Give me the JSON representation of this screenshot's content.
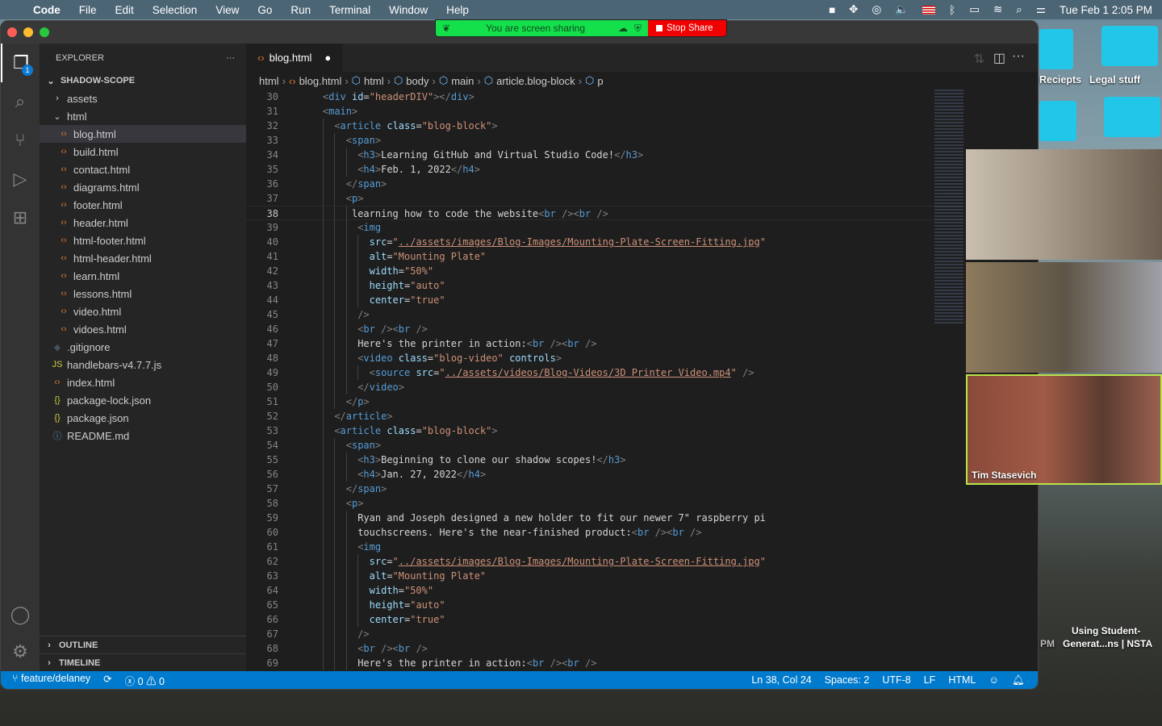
{
  "menubar": {
    "app": "Code",
    "items": [
      "File",
      "Edit",
      "Selection",
      "View",
      "Go",
      "Run",
      "Terminal",
      "Window",
      "Help"
    ],
    "clock": "Tue Feb 1  2:05 PM"
  },
  "share": {
    "status": "You are screen sharing",
    "stop": "Stop Share"
  },
  "desktop": {
    "folders": [
      "Reciepts",
      "Legal stuff"
    ],
    "bottom_label_1": "Using Student-",
    "bottom_label_2": "Generat...ns | NSTA",
    "pm": "PM"
  },
  "video": {
    "speaker": "Tim Stasevich"
  },
  "sidebar": {
    "title": "EXPLORER",
    "more": "···",
    "root": "SHADOW-SCOPE",
    "items": [
      {
        "label": "assets",
        "type": "folder",
        "depth": 1,
        "icon": "›"
      },
      {
        "label": "html",
        "type": "folder-open",
        "depth": 1,
        "icon": "⌄"
      },
      {
        "label": "blog.html",
        "type": "html",
        "depth": 2,
        "selected": true
      },
      {
        "label": "build.html",
        "type": "html",
        "depth": 2
      },
      {
        "label": "contact.html",
        "type": "html",
        "depth": 2
      },
      {
        "label": "diagrams.html",
        "type": "html",
        "depth": 2
      },
      {
        "label": "footer.html",
        "type": "html",
        "depth": 2
      },
      {
        "label": "header.html",
        "type": "html",
        "depth": 2
      },
      {
        "label": "html-footer.html",
        "type": "html",
        "depth": 2
      },
      {
        "label": "html-header.html",
        "type": "html",
        "depth": 2
      },
      {
        "label": "learn.html",
        "type": "html",
        "depth": 2
      },
      {
        "label": "lessons.html",
        "type": "html",
        "depth": 2
      },
      {
        "label": "video.html",
        "type": "html",
        "depth": 2
      },
      {
        "label": "vidoes.html",
        "type": "html",
        "depth": 2
      },
      {
        "label": ".gitignore",
        "type": "git",
        "depth": 1
      },
      {
        "label": "handlebars-v4.7.7.js",
        "type": "js",
        "depth": 1
      },
      {
        "label": "index.html",
        "type": "html",
        "depth": 1
      },
      {
        "label": "package-lock.json",
        "type": "json",
        "depth": 1
      },
      {
        "label": "package.json",
        "type": "json",
        "depth": 1
      },
      {
        "label": "README.md",
        "type": "info",
        "depth": 1
      }
    ],
    "outline": "OUTLINE",
    "timeline": "TIMELINE"
  },
  "explorer_badge": "1",
  "editor": {
    "tab": "blog.html",
    "breadcrumb": [
      "html",
      "blog.html",
      "html",
      "body",
      "main",
      "article.blog-block",
      "p"
    ],
    "current_line": 38,
    "lines": [
      [
        30,
        4,
        [
          [
            "p",
            "<"
          ],
          [
            "g",
            "div "
          ],
          [
            "a",
            "id"
          ],
          [
            "x",
            "="
          ],
          [
            "s",
            "\"headerDIV\""
          ],
          [
            "p",
            "></"
          ],
          [
            "g",
            "div"
          ],
          [
            "p",
            ">"
          ]
        ]
      ],
      [
        31,
        4,
        [
          [
            "p",
            "<"
          ],
          [
            "g",
            "main"
          ],
          [
            "p",
            ">"
          ]
        ]
      ],
      [
        32,
        6,
        [
          [
            "p",
            "<"
          ],
          [
            "g",
            "article "
          ],
          [
            "a",
            "class"
          ],
          [
            "x",
            "="
          ],
          [
            "s",
            "\"blog-block\""
          ],
          [
            "p",
            ">"
          ]
        ]
      ],
      [
        33,
        8,
        [
          [
            "p",
            "<"
          ],
          [
            "g",
            "span"
          ],
          [
            "p",
            ">"
          ]
        ]
      ],
      [
        34,
        10,
        [
          [
            "p",
            "<"
          ],
          [
            "g",
            "h3"
          ],
          [
            "p",
            ">"
          ],
          [
            "x",
            "Learning GitHub and Virtual Studio Code!"
          ],
          [
            "p",
            "</"
          ],
          [
            "g",
            "h3"
          ],
          [
            "p",
            ">"
          ]
        ]
      ],
      [
        35,
        10,
        [
          [
            "p",
            "<"
          ],
          [
            "g",
            "h4"
          ],
          [
            "p",
            ">"
          ],
          [
            "x",
            "Feb. 1, 2022"
          ],
          [
            "p",
            "</"
          ],
          [
            "g",
            "h4"
          ],
          [
            "p",
            ">"
          ]
        ]
      ],
      [
        36,
        8,
        [
          [
            "p",
            "</"
          ],
          [
            "g",
            "span"
          ],
          [
            "p",
            ">"
          ]
        ]
      ],
      [
        37,
        8,
        [
          [
            "p",
            "<"
          ],
          [
            "g",
            "p"
          ],
          [
            "p",
            ">"
          ]
        ]
      ],
      [
        38,
        9,
        [
          [
            "x",
            "learning how to code the website"
          ],
          [
            "p",
            "<"
          ],
          [
            "g",
            "br"
          ],
          [
            "p",
            " /><"
          ],
          [
            "g",
            "br"
          ],
          [
            "p",
            " />"
          ]
        ]
      ],
      [
        39,
        10,
        [
          [
            "p",
            "<"
          ],
          [
            "g",
            "img"
          ]
        ]
      ],
      [
        40,
        12,
        [
          [
            "a",
            "src"
          ],
          [
            "x",
            "="
          ],
          [
            "s",
            "\""
          ],
          [
            "u",
            "../assets/images/Blog-Images/Mounting-Plate-Screen-Fitting.jpg"
          ],
          [
            "s",
            "\""
          ]
        ]
      ],
      [
        41,
        12,
        [
          [
            "a",
            "alt"
          ],
          [
            "x",
            "="
          ],
          [
            "s",
            "\"Mounting Plate\""
          ]
        ]
      ],
      [
        42,
        12,
        [
          [
            "a",
            "width"
          ],
          [
            "x",
            "="
          ],
          [
            "s",
            "\"50%\""
          ]
        ]
      ],
      [
        43,
        12,
        [
          [
            "a",
            "height"
          ],
          [
            "x",
            "="
          ],
          [
            "s",
            "\"auto\""
          ]
        ]
      ],
      [
        44,
        12,
        [
          [
            "a",
            "center"
          ],
          [
            "x",
            "="
          ],
          [
            "s",
            "\"true\""
          ]
        ]
      ],
      [
        45,
        10,
        [
          [
            "p",
            "/>"
          ]
        ]
      ],
      [
        46,
        10,
        [
          [
            "p",
            "<"
          ],
          [
            "g",
            "br"
          ],
          [
            "p",
            " /><"
          ],
          [
            "g",
            "br"
          ],
          [
            "p",
            " />"
          ]
        ]
      ],
      [
        47,
        10,
        [
          [
            "x",
            "Here's the printer in action:"
          ],
          [
            "p",
            "<"
          ],
          [
            "g",
            "br"
          ],
          [
            "p",
            " /><"
          ],
          [
            "g",
            "br"
          ],
          [
            "p",
            " />"
          ]
        ]
      ],
      [
        48,
        10,
        [
          [
            "p",
            "<"
          ],
          [
            "g",
            "video "
          ],
          [
            "a",
            "class"
          ],
          [
            "x",
            "="
          ],
          [
            "s",
            "\"blog-video\" "
          ],
          [
            "a",
            "controls"
          ],
          [
            "p",
            ">"
          ]
        ]
      ],
      [
        49,
        12,
        [
          [
            "p",
            "<"
          ],
          [
            "g",
            "source "
          ],
          [
            "a",
            "src"
          ],
          [
            "x",
            "="
          ],
          [
            "s",
            "\""
          ],
          [
            "u",
            "../assets/videos/Blog-Videos/3D Printer Video.mp4"
          ],
          [
            "s",
            "\""
          ],
          [
            "p",
            " />"
          ]
        ]
      ],
      [
        50,
        10,
        [
          [
            "p",
            "</"
          ],
          [
            "g",
            "video"
          ],
          [
            "p",
            ">"
          ]
        ]
      ],
      [
        51,
        8,
        [
          [
            "p",
            "</"
          ],
          [
            "g",
            "p"
          ],
          [
            "p",
            ">"
          ]
        ]
      ],
      [
        52,
        6,
        [
          [
            "p",
            "</"
          ],
          [
            "g",
            "article"
          ],
          [
            "p",
            ">"
          ]
        ]
      ],
      [
        53,
        6,
        [
          [
            "p",
            "<"
          ],
          [
            "g",
            "article "
          ],
          [
            "a",
            "class"
          ],
          [
            "x",
            "="
          ],
          [
            "s",
            "\"blog-block\""
          ],
          [
            "p",
            ">"
          ]
        ]
      ],
      [
        54,
        8,
        [
          [
            "p",
            "<"
          ],
          [
            "g",
            "span"
          ],
          [
            "p",
            ">"
          ]
        ]
      ],
      [
        55,
        10,
        [
          [
            "p",
            "<"
          ],
          [
            "g",
            "h3"
          ],
          [
            "p",
            ">"
          ],
          [
            "x",
            "Beginning to clone our shadow scopes!"
          ],
          [
            "p",
            "</"
          ],
          [
            "g",
            "h3"
          ],
          [
            "p",
            ">"
          ]
        ]
      ],
      [
        56,
        10,
        [
          [
            "p",
            "<"
          ],
          [
            "g",
            "h4"
          ],
          [
            "p",
            ">"
          ],
          [
            "x",
            "Jan. 27, 2022"
          ],
          [
            "p",
            "</"
          ],
          [
            "g",
            "h4"
          ],
          [
            "p",
            ">"
          ]
        ]
      ],
      [
        57,
        8,
        [
          [
            "p",
            "</"
          ],
          [
            "g",
            "span"
          ],
          [
            "p",
            ">"
          ]
        ]
      ],
      [
        58,
        8,
        [
          [
            "p",
            "<"
          ],
          [
            "g",
            "p"
          ],
          [
            "p",
            ">"
          ]
        ]
      ],
      [
        59,
        10,
        [
          [
            "x",
            "Ryan and Joseph designed a new holder to fit our newer 7\" raspberry pi"
          ]
        ]
      ],
      [
        60,
        10,
        [
          [
            "x",
            "touchscreens. Here's the near-finished product:"
          ],
          [
            "p",
            "<"
          ],
          [
            "g",
            "br"
          ],
          [
            "p",
            " /><"
          ],
          [
            "g",
            "br"
          ],
          [
            "p",
            " />"
          ]
        ]
      ],
      [
        61,
        10,
        [
          [
            "p",
            "<"
          ],
          [
            "g",
            "img"
          ]
        ]
      ],
      [
        62,
        12,
        [
          [
            "a",
            "src"
          ],
          [
            "x",
            "="
          ],
          [
            "s",
            "\""
          ],
          [
            "u",
            "../assets/images/Blog-Images/Mounting-Plate-Screen-Fitting.jpg"
          ],
          [
            "s",
            "\""
          ]
        ]
      ],
      [
        63,
        12,
        [
          [
            "a",
            "alt"
          ],
          [
            "x",
            "="
          ],
          [
            "s",
            "\"Mounting Plate\""
          ]
        ]
      ],
      [
        64,
        12,
        [
          [
            "a",
            "width"
          ],
          [
            "x",
            "="
          ],
          [
            "s",
            "\"50%\""
          ]
        ]
      ],
      [
        65,
        12,
        [
          [
            "a",
            "height"
          ],
          [
            "x",
            "="
          ],
          [
            "s",
            "\"auto\""
          ]
        ]
      ],
      [
        66,
        12,
        [
          [
            "a",
            "center"
          ],
          [
            "x",
            "="
          ],
          [
            "s",
            "\"true\""
          ]
        ]
      ],
      [
        67,
        10,
        [
          [
            "p",
            "/>"
          ]
        ]
      ],
      [
        68,
        10,
        [
          [
            "p",
            "<"
          ],
          [
            "g",
            "br"
          ],
          [
            "p",
            " /><"
          ],
          [
            "g",
            "br"
          ],
          [
            "p",
            " />"
          ]
        ]
      ],
      [
        69,
        10,
        [
          [
            "x",
            "Here's the printer in action:"
          ],
          [
            "p",
            "<"
          ],
          [
            "g",
            "br"
          ],
          [
            "p",
            " /><"
          ],
          [
            "g",
            "br"
          ],
          [
            "p",
            " />"
          ]
        ]
      ]
    ]
  },
  "status": {
    "branch": "feature/delaney",
    "errors": "0",
    "warnings": "0",
    "position": "Ln 38, Col 24",
    "spaces": "Spaces: 2",
    "encoding": "UTF-8",
    "eol": "LF",
    "language": "HTML"
  },
  "colors": {
    "statusbar": "#007acc",
    "share_green": "#13e04a",
    "stop_red": "#f00000",
    "accent": "#569cd6"
  }
}
